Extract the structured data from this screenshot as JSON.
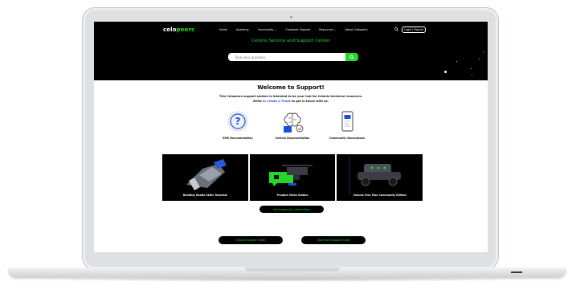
{
  "header": {
    "logo_main": "celo",
    "logo_accent": "peers",
    "nav": [
      "Home",
      "Academy",
      "Community ⌄",
      "Customer Support",
      "Resources ⌄",
      "About Celopeers"
    ],
    "login_label": "Login | Signup"
  },
  "hero": {
    "title": "Celonis Service and Support Center",
    "search_placeholder": "Type your question..."
  },
  "content": {
    "welcome": "Welcome to Support!",
    "intro_line1": "This Celopeers support section is intended to be your hub for Celonis technical resources.",
    "intro_pre": "Write",
    "intro_link": "or create a Ticket",
    "intro_post": "to get in touch with us."
  },
  "cards": [
    {
      "label": "EMS Documentation",
      "icon": "question-mark-icon"
    },
    {
      "label": "Celonis Documentation",
      "icon": "brain-icon"
    },
    {
      "label": "Community Discussions",
      "icon": "phone-icon"
    }
  ],
  "tiles": [
    {
      "label": "Building Studio Skills Tutorials",
      "icon": "studio-tutorial-image"
    },
    {
      "label": "Product Video Guides",
      "icon": "drone-video-image"
    },
    {
      "label": "Celonis Free Plan Community Edition",
      "icon": "vehicle-image"
    }
  ],
  "buttons": {
    "center": "Get support for Celonis Tools",
    "left": "Celonis Support Ticket",
    "right": "Start your Support Ticket"
  },
  "colors": {
    "accent": "#25d629",
    "hero_bg": "#000000",
    "link": "#1d4ed8"
  }
}
